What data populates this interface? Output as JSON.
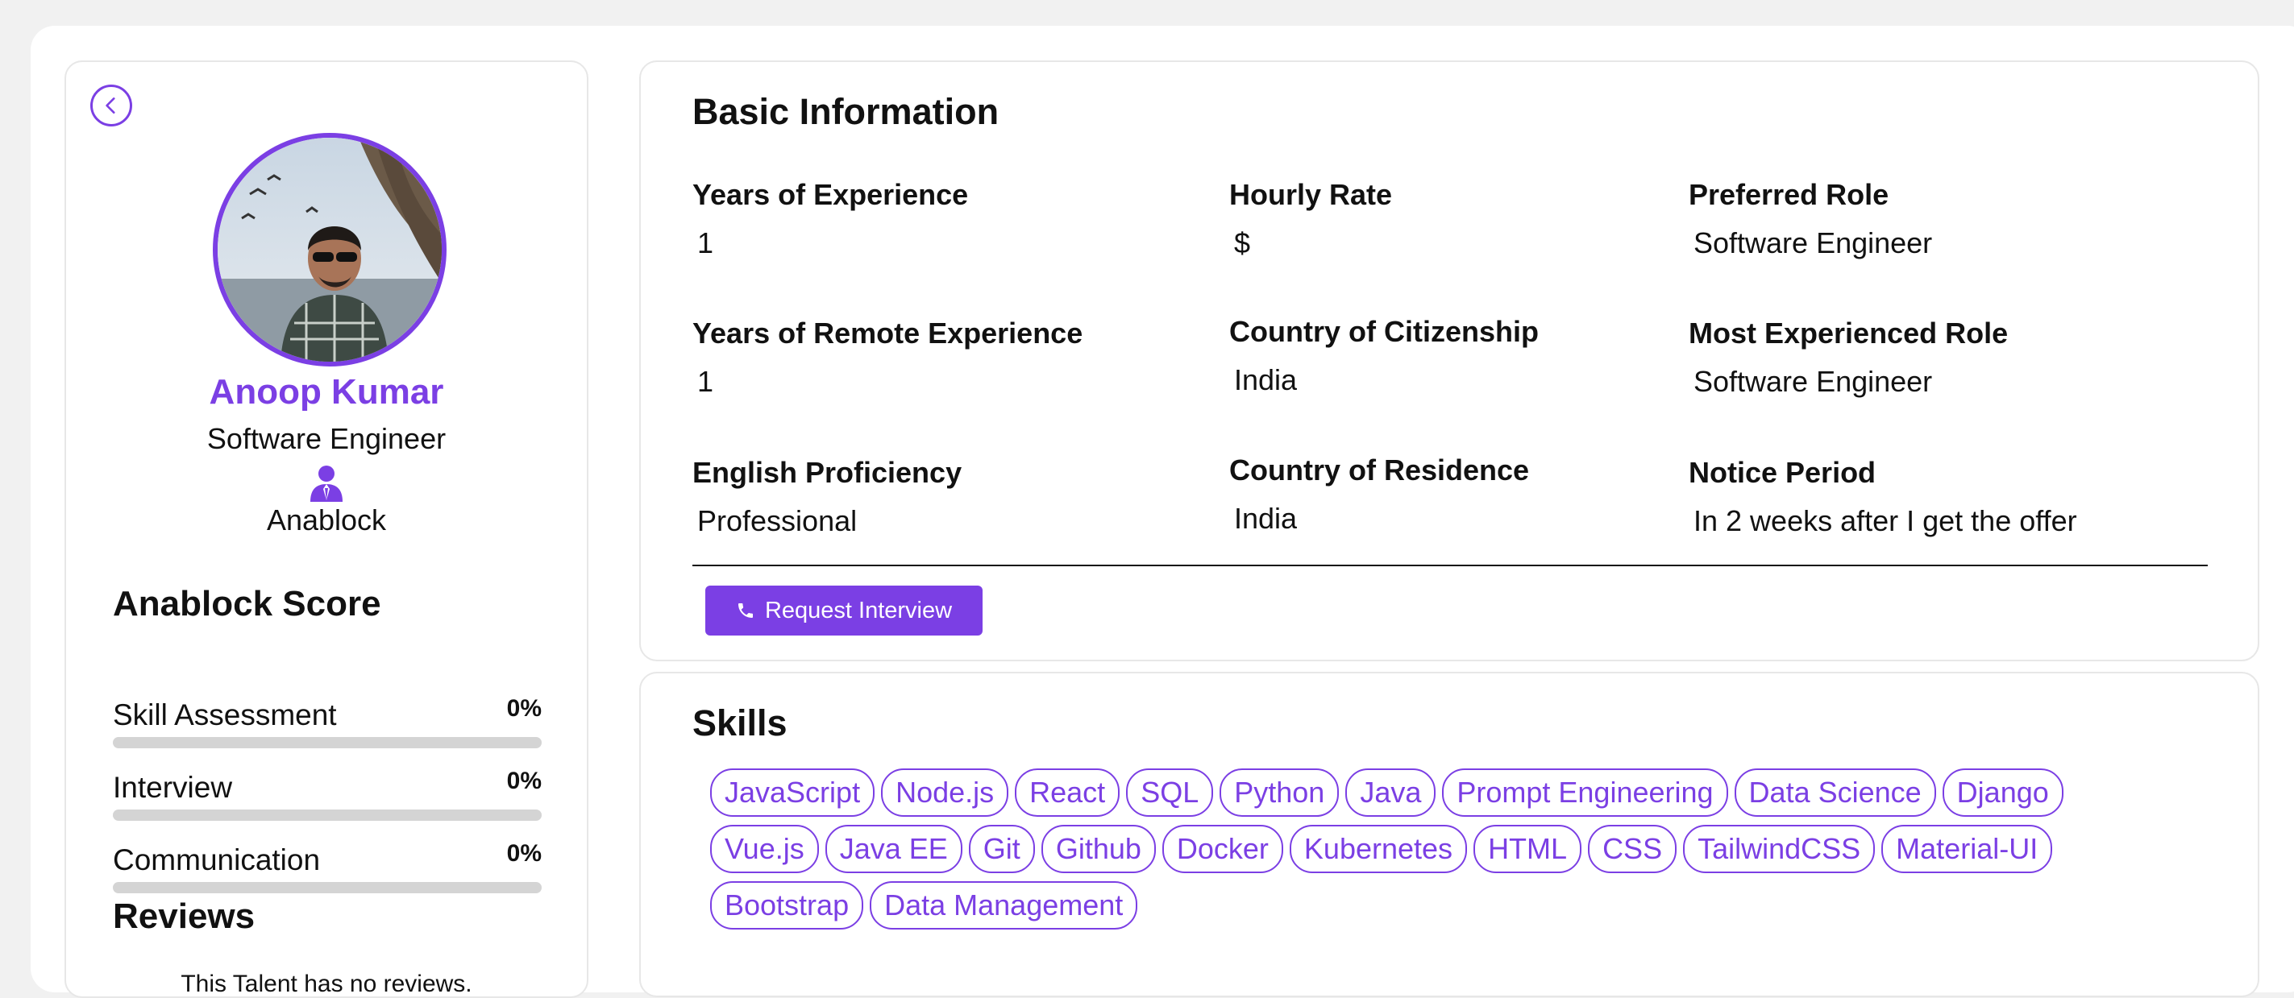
{
  "profile": {
    "name": "Anoop Kumar",
    "role": "Software Engineer",
    "company": "Anablock"
  },
  "score": {
    "title": "Anablock Score",
    "items": [
      {
        "label": "Skill Assessment",
        "value": "0%",
        "percent": 0
      },
      {
        "label": "Interview",
        "value": "0%",
        "percent": 0
      },
      {
        "label": "Communication",
        "value": "0%",
        "percent": 0
      }
    ]
  },
  "reviews": {
    "title": "Reviews",
    "empty_text": "This Talent has no reviews."
  },
  "basic_info": {
    "title": "Basic Information",
    "fields": [
      {
        "label": "Years of Experience",
        "value": "1"
      },
      {
        "label": "Hourly Rate",
        "value": "$"
      },
      {
        "label": "Preferred Role",
        "value": "Software Engineer"
      },
      {
        "label": "Years of Remote Experience",
        "value": "1"
      },
      {
        "label": "Country of Citizenship",
        "value": "India"
      },
      {
        "label": "Most Experienced Role",
        "value": "Software Engineer"
      },
      {
        "label": "English Proficiency",
        "value": "Professional"
      },
      {
        "label": "Country of Residence",
        "value": "India"
      },
      {
        "label": "Notice Period",
        "value": "In 2 weeks after I get the offer"
      }
    ],
    "request_button": "Request Interview"
  },
  "skills": {
    "title": "Skills",
    "tags": [
      "JavaScript",
      "Node.js",
      "React",
      "SQL",
      "Python",
      "Java",
      "Prompt Engineering",
      "Data Science",
      "Django",
      "Vue.js",
      "Java EE",
      "Git",
      "Github",
      "Docker",
      "Kubernetes",
      "HTML",
      "CSS",
      "TailwindCSS",
      "Material-UI",
      "Bootstrap",
      "Data Management"
    ]
  },
  "colors": {
    "accent": "#7b3fe4",
    "bar_track": "#d4d4d4"
  },
  "icons": {
    "back": "chevron-left-icon",
    "company": "user-tie-icon",
    "phone": "phone-icon"
  }
}
